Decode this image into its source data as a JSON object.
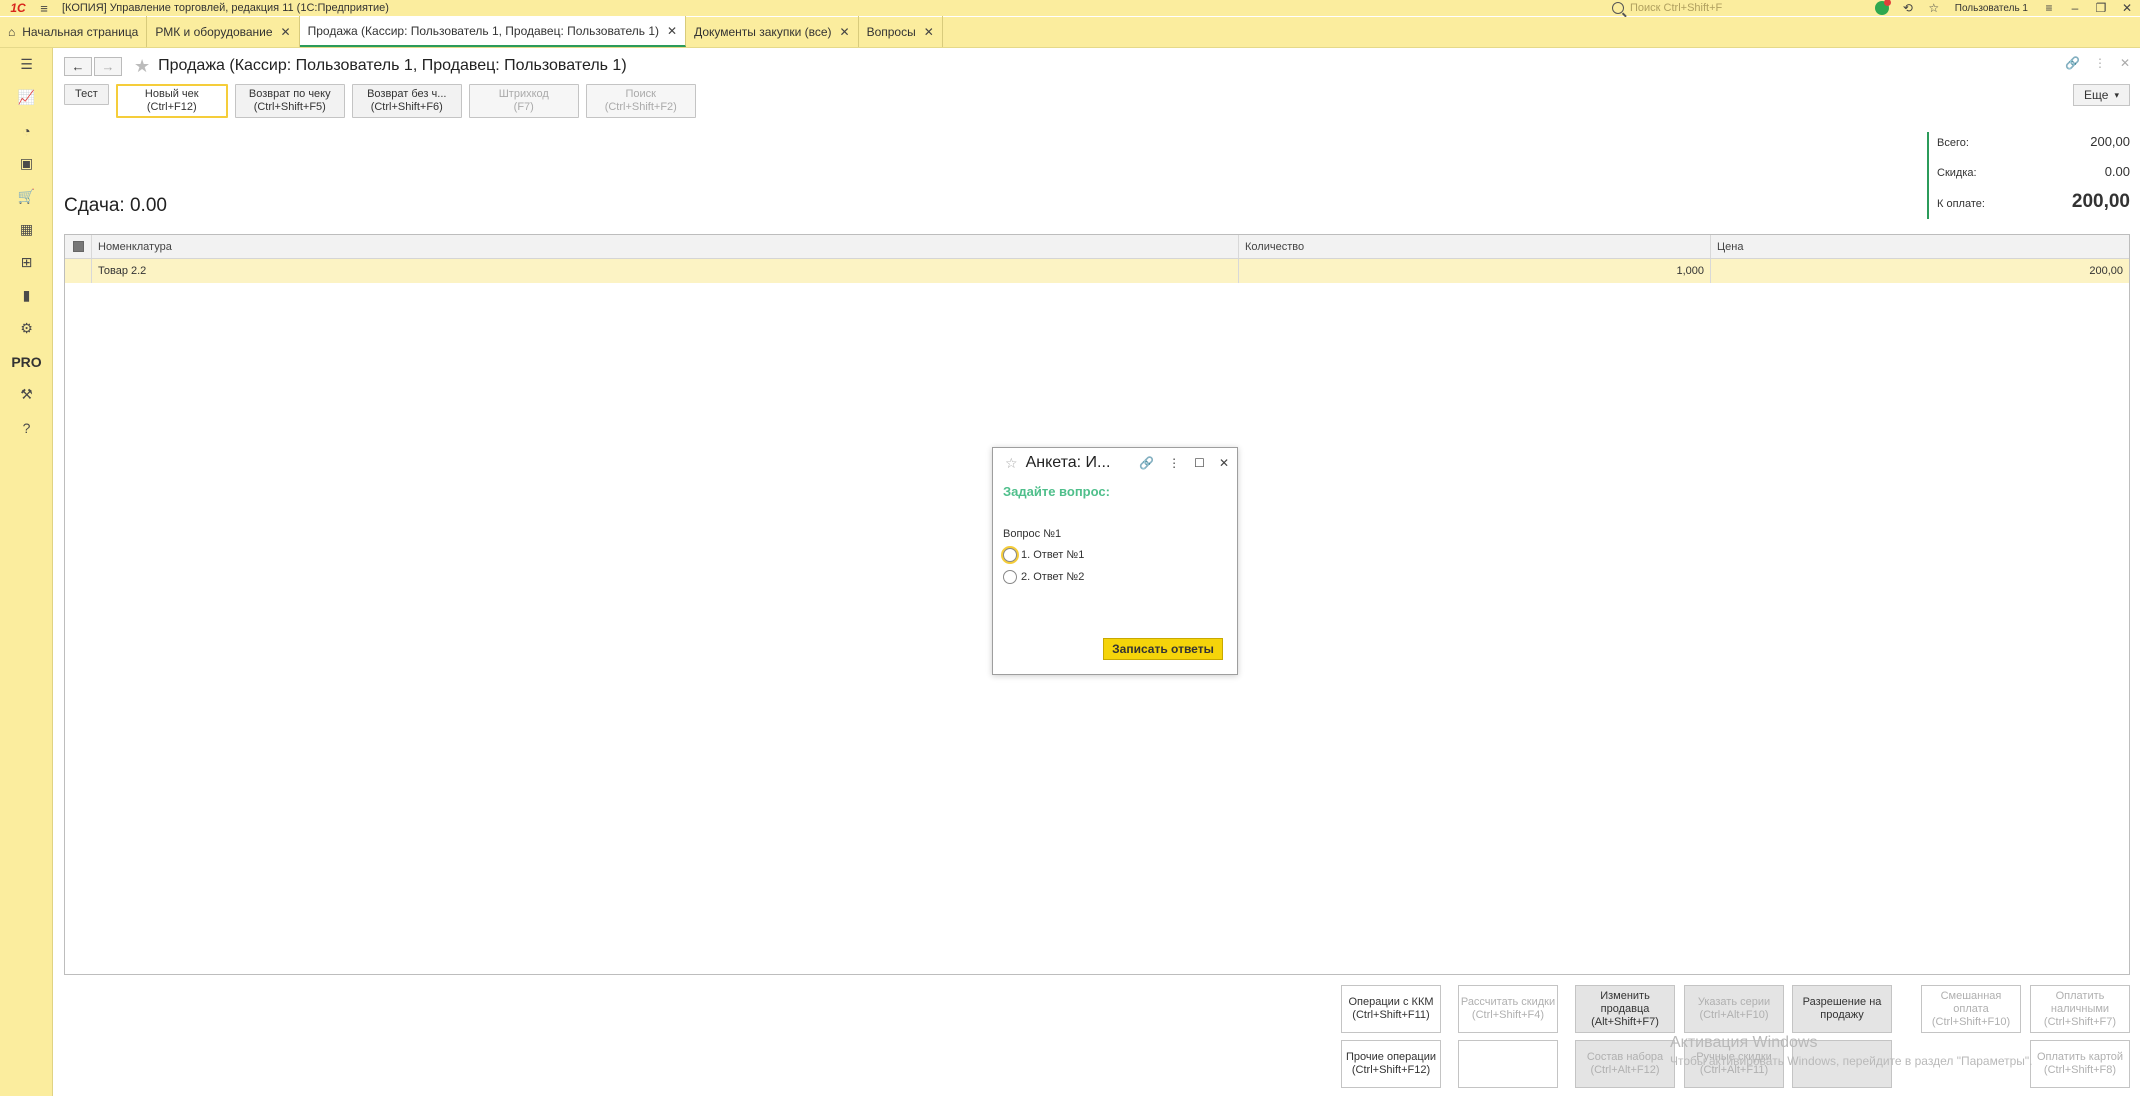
{
  "titlebar": {
    "logo": "1С",
    "app_title": "[КОПИЯ] Управление торговлей, редакция 11  (1С:Предприятие)",
    "search_placeholder": "Поиск Ctrl+Shift+F",
    "user": "Пользователь 1"
  },
  "tabs": [
    {
      "label": "Начальная страница"
    },
    {
      "label": "РМК и оборудование"
    },
    {
      "label": "Продажа (Кассир: Пользователь 1, Продавец: Пользователь 1)"
    },
    {
      "label": "Документы закупки (все)"
    },
    {
      "label": "Вопросы"
    }
  ],
  "sidebar": {
    "items": [
      {
        "icon": "menu-icon"
      },
      {
        "icon": "chart-line-icon"
      },
      {
        "icon": "pie-chart-icon"
      },
      {
        "icon": "bag-icon"
      },
      {
        "icon": "cart-icon"
      },
      {
        "icon": "grid-icon"
      },
      {
        "icon": "stamp-icon"
      },
      {
        "icon": "bar-chart-icon"
      },
      {
        "icon": "gear-icon"
      },
      {
        "label": "PRO"
      },
      {
        "icon": "tools-icon"
      },
      {
        "icon": "help-icon"
      }
    ]
  },
  "document": {
    "title": "Продажа (Кассир: Пользователь 1, Продавец: Пользователь 1)"
  },
  "toolbar": {
    "test": "Тест",
    "new_check": {
      "l1": "Новый чек",
      "l2": "(Ctrl+F12)"
    },
    "return_by_check": {
      "l1": "Возврат по чеку",
      "l2": "(Ctrl+Shift+F5)"
    },
    "return_without": {
      "l1": "Возврат без ч...",
      "l2": "(Ctrl+Shift+F6)"
    },
    "barcode": {
      "l1": "Штрихкод",
      "l2": "(F7)"
    },
    "search": {
      "l1": "Поиск",
      "l2": "(Ctrl+Shift+F2)"
    },
    "more": "Еще"
  },
  "totals": {
    "total_label": "Всего:",
    "total_value": "200,00",
    "discount_label": "Скидка:",
    "discount_value": "0.00",
    "to_pay_label": "К оплате:",
    "to_pay_value": "200,00"
  },
  "change_text": "Сдача: 0.00",
  "table": {
    "headers": {
      "name": "Номенклатура",
      "qty": "Количество",
      "price": "Цена"
    },
    "rows": [
      {
        "name": "Товар 2.2",
        "qty": "1,000",
        "price": "200,00"
      }
    ]
  },
  "bottom_buttons": {
    "kkm_ops": "Операции с ККМ (Ctrl+Shift+F11)",
    "calc_discounts": "Рассчитать скидки (Ctrl+Shift+F4)",
    "change_seller": "Изменить продавца (Alt+Shift+F7)",
    "series": "Указать серии (Ctrl+Alt+F10)",
    "sale_permission": "Разрешение на продажу",
    "mixed_payment": "Смешанная оплата (Ctrl+Shift+F10)",
    "pay_cash": "Оплатить наличными (Ctrl+Shift+F7)",
    "other_ops": "Прочие операции (Ctrl+Shift+F12)",
    "empty": "",
    "kit": "Состав набора (Ctrl+Alt+F12)",
    "manual_discounts": "Ручные скидки (Ctrl+Alt+F11)",
    "empty2": "",
    "pay_card": "Оплатить картой (Ctrl+Shift+F8)"
  },
  "watermark": {
    "line1": "Активация Windows",
    "line2": "Чтобы активировать Windows, перейдите в раздел \"Параметры\"."
  },
  "dialog": {
    "title": "Анкета: И...",
    "subtitle": "Задайте вопрос:",
    "question": "Вопрос №1",
    "answers": [
      "1. Ответ №1",
      "2. Ответ №2"
    ],
    "submit": "Записать ответы"
  },
  "colors": {
    "sidebar_bg": "#fbed9e",
    "accent_green": "#2b9b5a",
    "dialog_subtitle": "#4fbf8b",
    "primary_button": "#f5d40a",
    "selected_row": "#fcf3c4"
  }
}
